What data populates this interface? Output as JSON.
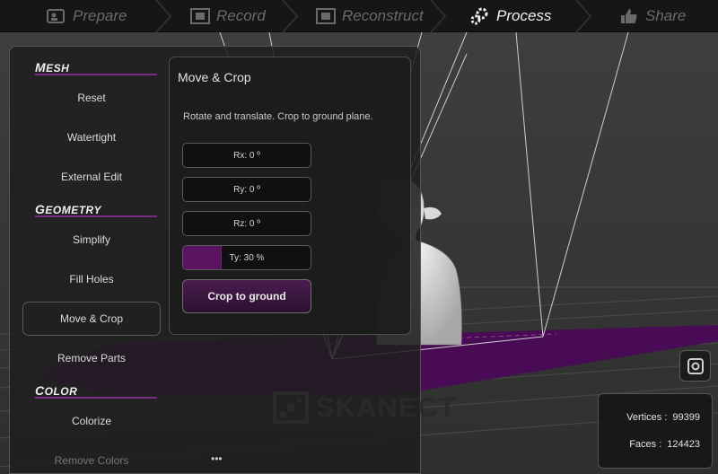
{
  "workflow": {
    "steps": [
      {
        "label": "Prepare",
        "icon": "id-card-icon",
        "active": false
      },
      {
        "label": "Record",
        "icon": "film-icon",
        "active": false
      },
      {
        "label": "Reconstruct",
        "icon": "film-icon",
        "active": false
      },
      {
        "label": "Process",
        "icon": "gears-icon",
        "active": true
      },
      {
        "label": "Share",
        "icon": "thumbs-up-icon",
        "active": false
      }
    ]
  },
  "sidebar": {
    "categories": [
      "Mesh",
      "Geometry",
      "Color"
    ],
    "mesh_items": [
      "Reset",
      "Watertight",
      "External Edit"
    ],
    "geometry_items": [
      "Simplify",
      "Fill Holes",
      "Move & Crop",
      "Remove Parts"
    ],
    "color_items": [
      "Colorize",
      "Remove Colors"
    ],
    "selected_item": "Move & Crop",
    "more_label": "•••"
  },
  "move_crop": {
    "title": "Move & Crop",
    "description": "Rotate and translate. Crop to ground plane.",
    "rx_label": "Rx: 0 º",
    "ry_label": "Ry: 0 º",
    "rz_label": "Rz: 0 º",
    "ty_label": "Ty: 30 %",
    "ty_fraction": 0.3,
    "crop_button": "Crop to ground"
  },
  "stats": {
    "vertices_label": "Vertices :",
    "vertices_value": "99399",
    "faces_label": "Faces :",
    "faces_value": "124423"
  },
  "logo": {
    "text": "SKANECT"
  },
  "colors": {
    "accent": "#5a1360",
    "ground_plane": "#4b0a56",
    "background": "#3b3b3b"
  }
}
